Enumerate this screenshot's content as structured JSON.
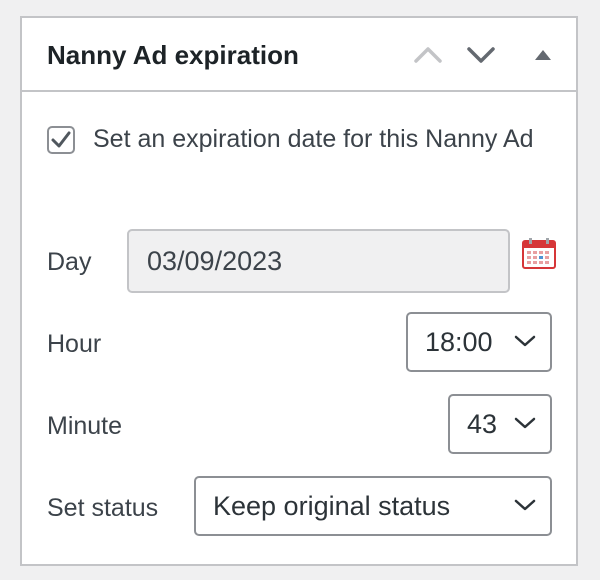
{
  "panel": {
    "title": "Nanny Ad expiration",
    "move_up_icon": "chevron-up-icon",
    "move_down_icon": "chevron-down-icon",
    "toggle_icon": "triangle-up-icon"
  },
  "expiration": {
    "enabled": true,
    "checkbox_label": "Set an expiration date for this Nanny Ad",
    "day_label": "Day",
    "day_value": "03/09/2023",
    "calendar_icon": "calendar-icon",
    "hour_label": "Hour",
    "hour_value": "18:00",
    "minute_label": "Minute",
    "minute_value": "43",
    "status_label": "Set status",
    "status_value": "Keep original status"
  },
  "colors": {
    "border": "#c3c4c7",
    "input_disabled_bg": "#f0f0f1",
    "text": "#1d2327",
    "icon_gray": "#8c8f94",
    "calendar_red": "#d63638"
  }
}
